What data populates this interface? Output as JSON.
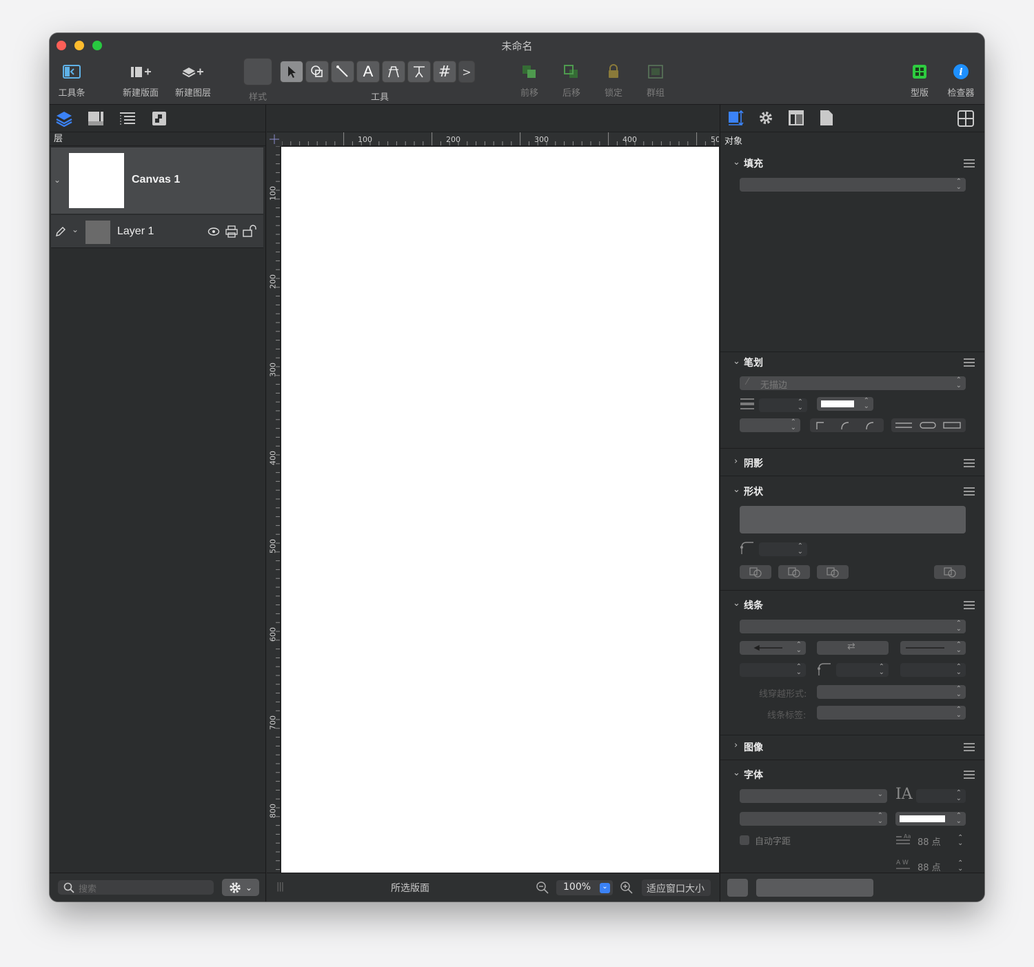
{
  "window": {
    "title": "未命名"
  },
  "toolbar": {
    "toolbar_label": "工具条",
    "new_canvas_label": "新建版面",
    "new_layer_label": "新建图层",
    "style_label": "样式",
    "tools_label": "工具",
    "forward_label": "前移",
    "backward_label": "后移",
    "lock_label": "锁定",
    "group_label": "群组",
    "stencils_label": "型版",
    "inspector_label": "检查器"
  },
  "sidebar": {
    "section_label": "层",
    "canvas_name": "Canvas 1",
    "layer_name": "Layer 1",
    "search_placeholder": "搜索"
  },
  "rulers": {
    "horizontal_ticks": [
      "100",
      "200",
      "300",
      "400",
      "50"
    ],
    "vertical_ticks": [
      "100",
      "200",
      "300",
      "400",
      "500",
      "600",
      "700",
      "800"
    ]
  },
  "canvas_bar": {
    "selected_canvas": "所选版面",
    "zoom": "100%",
    "fit_window": "适应窗口大小"
  },
  "inspector": {
    "object_label": "对象",
    "fill_title": "填充",
    "stroke_title": "笔划",
    "stroke_value": "无描边",
    "shadow_title": "阴影",
    "shape_title": "形状",
    "lines_title": "线条",
    "line_hops_label": "线穿越形式:",
    "line_label_label": "线条标签:",
    "image_title": "图像",
    "font_title": "字体",
    "auto_kerning": "自动字距",
    "line_spacing": "88 点",
    "char_spacing": "88 点"
  },
  "colors": {
    "accent_blue": "#3b82f6",
    "green_icon": "#2ecc40",
    "info_blue": "#1e90ff"
  }
}
